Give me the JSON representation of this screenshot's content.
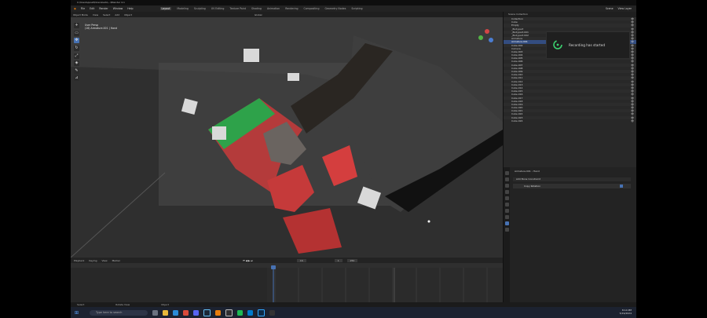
{
  "window": {
    "title": "C:\\Users\\quiet\\Downloads\\...\\Blender 4.1"
  },
  "menu": {
    "items": [
      "File",
      "Edit",
      "Render",
      "Window",
      "Help"
    ],
    "workspaces": [
      "Layout",
      "Modeling",
      "Sculpting",
      "UV Editing",
      "Texture Paint",
      "Shading",
      "Animation",
      "Rendering",
      "Compositing",
      "Geometry Nodes",
      "Scripting"
    ],
    "active_workspace": "Layout",
    "scene": "Scene",
    "view_layer": "View Layer"
  },
  "viewport": {
    "header": [
      "Object Mode",
      "View",
      "Select",
      "Add",
      "Object"
    ],
    "info_line1": "User Persp",
    "info_line2": "(16) Armature.001 | Hand",
    "shading": "Global"
  },
  "timeline": {
    "menus": [
      "Playback",
      "Keying",
      "View",
      "Marker"
    ],
    "current_frame": "16",
    "start": "1",
    "end": "250"
  },
  "outliner": {
    "title": "Scene Collection",
    "rows": [
      "Collection",
      "Cube",
      "Empty",
      "_Bodypart",
      "_Bodypart.001",
      "_Bodypart.002",
      "Armature",
      "Armature.001",
      "Cube.002",
      "Camera",
      "Cube.003",
      "Cube.004",
      "Cube.005",
      "Cube.006",
      "Cube.007",
      "Cube.008",
      "Cube.009",
      "Cube.010",
      "Cube.011",
      "Cube.012",
      "Cube.013",
      "Cube.014",
      "Cube.015",
      "Cube.016",
      "Cube.017",
      "Cube.018",
      "Cube.019",
      "Cube.020",
      "Cube.021",
      "Cube.022",
      "Cube.023",
      "Cube.024"
    ],
    "selected_row": "Armature.001",
    "search_placeholder": ""
  },
  "recording": {
    "text": "Recording has started"
  },
  "properties": {
    "breadcrumb": [
      "Armature.001",
      "Hand"
    ],
    "section": "Add Bone Constraint",
    "constraint": "Copy Rotation"
  },
  "statusbar": {
    "items": [
      "Select",
      "Rotate View",
      "Object"
    ]
  },
  "taskbar": {
    "search_placeholder": "Type here to search",
    "time": "8:14 PM",
    "date": "5/19/2024"
  },
  "colors": {
    "accent": "#4772b3",
    "selected": "#334d80",
    "recording_green": "#3bd16f",
    "collection_green": "#6ae38f"
  }
}
